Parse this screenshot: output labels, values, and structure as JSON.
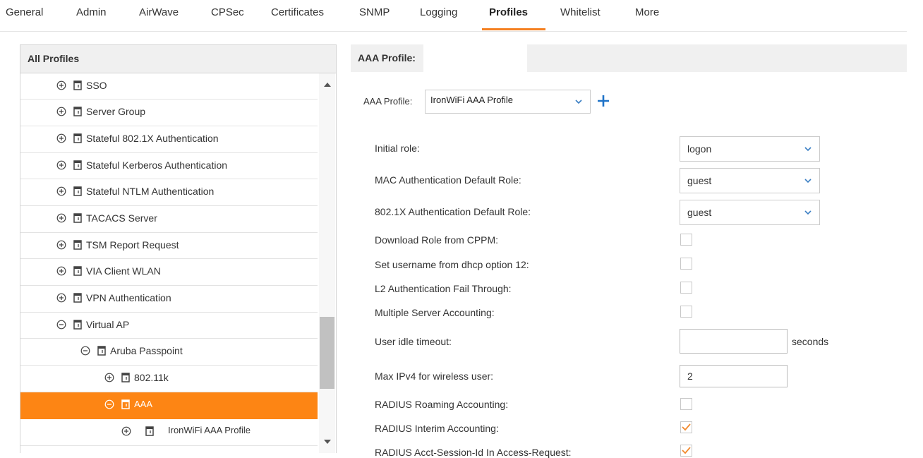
{
  "tabs": [
    "General",
    "Admin",
    "AirWave",
    "CPSec",
    "Certificates",
    "SNMP",
    "Logging",
    "Profiles",
    "Whitelist",
    "More"
  ],
  "active_tab": "Profiles",
  "accent_color": "#f47f20",
  "left_panel": {
    "title": "All Profiles",
    "items": [
      {
        "label": "SSO",
        "toggle": "plus"
      },
      {
        "label": "Server Group",
        "toggle": "plus"
      },
      {
        "label": "Stateful 802.1X Authentication",
        "toggle": "plus"
      },
      {
        "label": "Stateful Kerberos Authentication",
        "toggle": "plus"
      },
      {
        "label": "Stateful NTLM Authentication",
        "toggle": "plus"
      },
      {
        "label": "TACACS Server",
        "toggle": "plus"
      },
      {
        "label": "TSM Report Request",
        "toggle": "plus"
      },
      {
        "label": "VIA Client WLAN",
        "toggle": "plus"
      },
      {
        "label": "VPN Authentication",
        "toggle": "plus"
      },
      {
        "label": "Virtual AP",
        "toggle": "minus"
      },
      {
        "label": "Aruba Passpoint",
        "toggle": "minus"
      },
      {
        "label": "802.11k",
        "toggle": "plus"
      },
      {
        "label": "AAA",
        "toggle": "minus",
        "selected": true
      },
      {
        "label": "IronWiFi AAA Profile",
        "toggle": "plus"
      }
    ]
  },
  "right_panel": {
    "header_title": "AAA Profile:",
    "profile_label": "AAA Profile:",
    "profile_value": "IronWiFi AAA Profile",
    "fields": {
      "initial_role": {
        "label": "Initial role:",
        "value": "logon"
      },
      "mac_auth_default_role": {
        "label": "MAC Authentication Default Role:",
        "value": "guest"
      },
      "dot1x_auth_default_role": {
        "label": "802.1X Authentication Default Role:",
        "value": "guest"
      },
      "download_role_cppm": {
        "label": "Download Role from CPPM:",
        "checked": false
      },
      "set_username_dhcp": {
        "label": "Set username from dhcp option 12:",
        "checked": false
      },
      "l2_auth_fail_through": {
        "label": "L2 Authentication Fail Through:",
        "checked": false
      },
      "multiple_server_accounting": {
        "label": "Multiple Server Accounting:",
        "checked": false
      },
      "user_idle_timeout": {
        "label": "User idle timeout:",
        "value": "",
        "unit": "seconds"
      },
      "max_ipv4": {
        "label": "Max IPv4 for wireless user:",
        "value": "2"
      },
      "radius_roaming_accounting": {
        "label": "RADIUS Roaming Accounting:",
        "checked": false
      },
      "radius_interim_accounting": {
        "label": "RADIUS Interim Accounting:",
        "checked": true
      },
      "radius_acct_session_id": {
        "label": "RADIUS Acct-Session-Id In Access-Request:",
        "checked": true
      }
    }
  }
}
